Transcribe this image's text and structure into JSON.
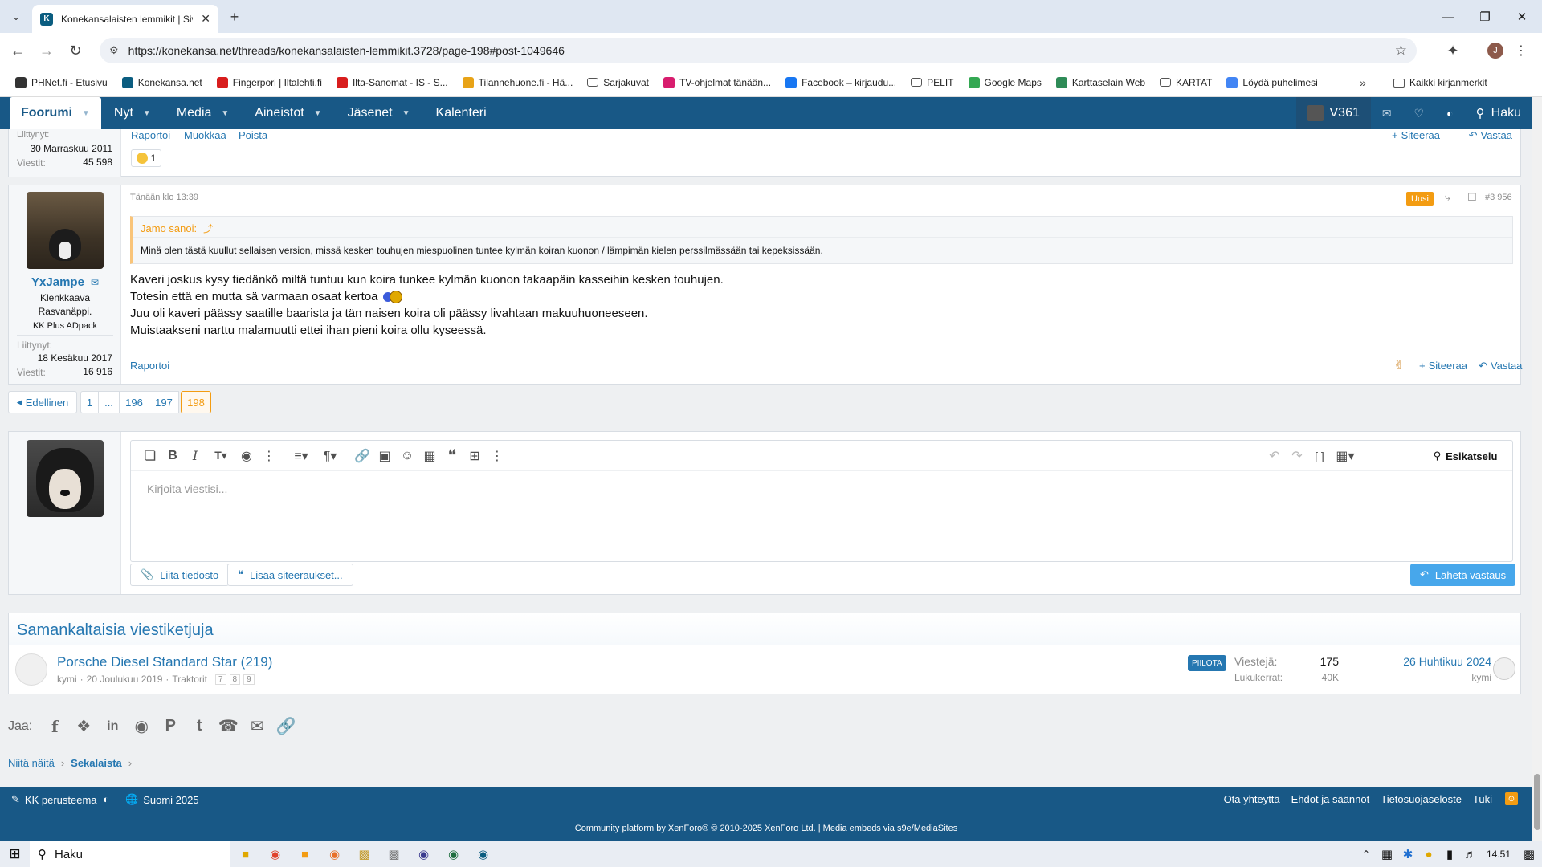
{
  "browser": {
    "tab_title": "Konekansalaisten lemmikit | Siv",
    "url": "https://konekansa.net/threads/konekansalaisten-lemmikit.3728/page-198#post-1049646",
    "profile_initial": "J",
    "bookmarks": [
      {
        "label": "PHNet.fi - Etusivu",
        "color": "#333333"
      },
      {
        "label": "Konekansa.net",
        "color": "#0b5d80"
      },
      {
        "label": "Fingerpori | Iltalehti.fi",
        "color": "#d81d1d"
      },
      {
        "label": "Ilta-Sanomat - IS - S...",
        "color": "#d81d1d"
      },
      {
        "label": "Tilannehuone.fi - Hä...",
        "color": "#e8a317"
      },
      {
        "label": "Sarjakuvat",
        "color": "folder"
      },
      {
        "label": "TV-ohjelmat tänään...",
        "color": "#d81d6e"
      },
      {
        "label": "Facebook – kirjaudu...",
        "color": "#1877f2"
      },
      {
        "label": "PELIT",
        "color": "folder"
      },
      {
        "label": "Google Maps",
        "color": "#34a853"
      },
      {
        "label": "Karttaselain Web",
        "color": "#2e8b57"
      },
      {
        "label": "KARTAT",
        "color": "folder"
      },
      {
        "label": "Löydä puhelimesi",
        "color": "#4285f4"
      }
    ],
    "all_bookmarks": "Kaikki kirjanmerkit"
  },
  "nav": {
    "items": [
      "Foorumi",
      "Nyt",
      "Media",
      "Aineistot",
      "Jäsenet",
      "Kalenteri"
    ],
    "user": "V361",
    "search": "Haku"
  },
  "prev_post": {
    "joined_label": "Liittynyt:",
    "joined": "30 Marraskuu 2011",
    "messages_label": "Viestit:",
    "messages": "45 598",
    "actions": [
      "Raportoi",
      "Muokkaa",
      "Poista"
    ],
    "reaction_count": "1",
    "quote_btn": "Siteeraa",
    "reply_btn": "Vastaa"
  },
  "post": {
    "time": "Tänään klo 13:39",
    "new_badge": "Uusi",
    "number": "#3 956",
    "username": "YxJampe",
    "title1": "Klenkkaava",
    "title2": "Rasvanäppi.",
    "banner": "KK Plus ADpack",
    "joined_label": "Liittynyt:",
    "joined": "18 Kesäkuu 2017",
    "messages_label": "Viestit:",
    "messages": "16 916",
    "quote_author": "Jamo sanoi:",
    "quote_text": "Minä olen tästä kuullut sellaisen version, missä kesken touhujen miespuolinen tuntee kylmän koiran kuonon / lämpimän kielen perssilmässään tai kepeksissään.",
    "lines": [
      "Kaveri joskus kysy tiedänkö miltä tuntuu kun koira tunkee kylmän kuonon takaapäin kasseihin kesken touhujen.",
      "Totesin että en mutta sä varmaan osaat kertoa",
      "Juu oli kaveri päässy saatille baarista ja tän naisen koira oli päässy livahtaan makuuhuoneeseen.",
      "Muistaakseni narttu malamuutti ettei ihan pieni koira ollu kyseessä."
    ],
    "report": "Raportoi",
    "quote_btn": "Siteeraa",
    "reply_btn": "Vastaa"
  },
  "pagination": {
    "prev": "Edellinen",
    "pages": [
      "1",
      "...",
      "196",
      "197",
      "198"
    ],
    "current": "198"
  },
  "editor": {
    "placeholder": "Kirjoita viestisi...",
    "preview": "Esikatselu",
    "attach": "Liitä tiedosto",
    "insert_quotes": "Lisää siteeraukset...",
    "submit": "Lähetä vastaus"
  },
  "similar": {
    "heading": "Samankaltaisia viestiketjuja",
    "thread_title": "Porsche Diesel Standard Star (219)",
    "meta_author": "kymi",
    "meta_date": "20 Joulukuu 2019",
    "meta_forum": "Traktorit",
    "meta_pages": [
      "7",
      "8",
      "9"
    ],
    "tag": "PIILOTA",
    "replies_label": "Viestejä:",
    "replies": "175",
    "views_label": "Lukukerrat:",
    "views": "40K",
    "last_date": "26 Huhtikuu 2024",
    "last_user": "kymi"
  },
  "share": {
    "label": "Jaa:"
  },
  "breadcrumb": [
    "Niitä näitä",
    "Sekalaista"
  ],
  "footer": {
    "style": "KK perusteema",
    "language": "Suomi 2025",
    "links": [
      "Ota yhteyttä",
      "Ehdot ja säännöt",
      "Tietosuojaseloste",
      "Tuki"
    ],
    "copyright": "Community platform by XenForo® © 2010-2025 XenForo Ltd. | Media embeds via s9e/MediaSites"
  },
  "taskbar": {
    "search": "Haku",
    "time": "14.51"
  },
  "colors": {
    "nav_bg": "#185886",
    "link": "#2577b1",
    "accent_badge": "#f39c12",
    "primary_button": "#47a7eb"
  }
}
